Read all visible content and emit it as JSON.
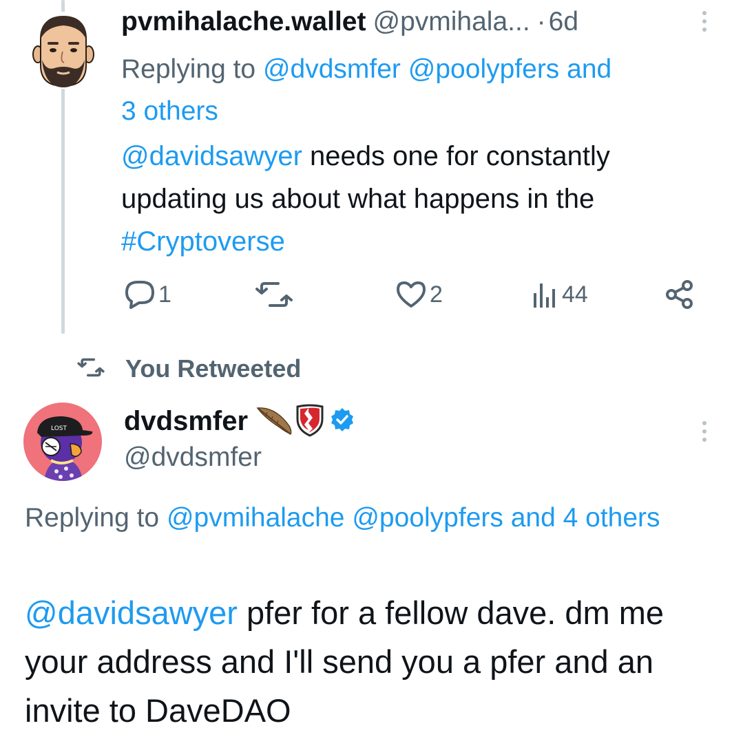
{
  "tweet1": {
    "display_name": "pvmihalache.wallet",
    "handle": "@pvmihala...",
    "separator": "·",
    "time": "6d",
    "replying_prefix": "Replying to ",
    "replying_user1": "@dvdsmfer",
    "replying_user2": "@poolypfers",
    "replying_and": " and",
    "replying_others": "3 others",
    "mention": "@davidsawyer",
    "body": " needs one for constantly updating us about what happens in the ",
    "hashtag": "#Cryptoverse",
    "actions": {
      "reply_count": "1",
      "retweet_count": "",
      "like_count": "2",
      "views_count": "44"
    }
  },
  "retweet_indicator": {
    "label": "You Retweeted"
  },
  "tweet2": {
    "display_name": "dvdsmfer",
    "handle": "@dvdsmfer",
    "replying_prefix": "Replying to ",
    "replying_user1": "@pvmihalache",
    "replying_user2": "@poolypfers",
    "replying_and": " and 4 others",
    "mention": "@davidsawyer",
    "body": " pfer for a fellow dave. dm me your address and I'll send you a pfer and an invite to DaveDAO"
  },
  "colors": {
    "accent": "#1d9bf0",
    "text": "#0f1419",
    "secondary": "#536471",
    "thread_line": "#cfd9de"
  },
  "icons": {
    "reply": "speech-bubble-icon",
    "retweet": "retweet-arrows-icon",
    "like": "heart-icon",
    "views": "bar-chart-icon",
    "share": "share-nodes-icon",
    "more": "vertical-ellipsis-icon",
    "verified": "verified-badge-icon"
  }
}
